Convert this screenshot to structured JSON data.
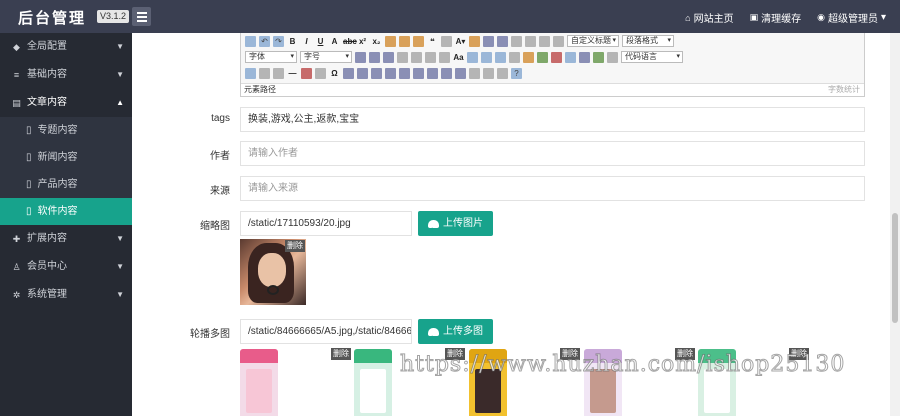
{
  "header": {
    "brand": "后台管理",
    "version": "V3.1.2",
    "links": [
      {
        "icon": "home-icon",
        "glyph": "⌂",
        "label": "网站主页"
      },
      {
        "icon": "cache-icon",
        "glyph": "▣",
        "label": "清理缓存"
      },
      {
        "icon": "user-icon",
        "glyph": "◉",
        "label": "超级管理员"
      }
    ]
  },
  "sidebar": {
    "items": [
      {
        "label": "全局配置",
        "glyph": "◆",
        "arrow": "▼"
      },
      {
        "label": "基础内容",
        "glyph": "≡",
        "arrow": "▼"
      },
      {
        "label": "文章内容",
        "glyph": "▤",
        "arrow": "▲"
      },
      {
        "label": "扩展内容",
        "glyph": "✚",
        "arrow": "▼"
      },
      {
        "label": "会员中心",
        "glyph": "♙",
        "arrow": "▼"
      },
      {
        "label": "系统管理",
        "glyph": "✲",
        "arrow": "▼"
      }
    ],
    "subitems": [
      "专题内容",
      "新闻内容",
      "产品内容",
      "软件内容"
    ]
  },
  "editor": {
    "font_select": "字体",
    "size_select": "字号",
    "heading_select": "自定义标题",
    "para_select": "段落格式",
    "lang_select": "代码语言",
    "path_label": "元素路径",
    "word_count": "字数统计"
  },
  "form": {
    "tags_label": "tags",
    "tags_value": "换装,游戏,公主,返款,宝宝",
    "author_label": "作者",
    "author_placeholder": "请输入作者",
    "source_label": "来源",
    "source_placeholder": "请输入来源",
    "thumb_label": "缩略图",
    "thumb_value": "/static/17110593/20.jpg",
    "upload_image_label": "上传图片",
    "carousel_label": "轮播多图",
    "carousel_value": "/static/84666665/A5.jpg,/static/84666665",
    "upload_multi_label": "上传多图",
    "delete_label": "删除"
  },
  "watermark": "https://www.huzhan.com/ishop25130",
  "colors": {
    "topbar": "#3a3f51",
    "sidebar": "#262a33",
    "accent": "#17a38c"
  }
}
